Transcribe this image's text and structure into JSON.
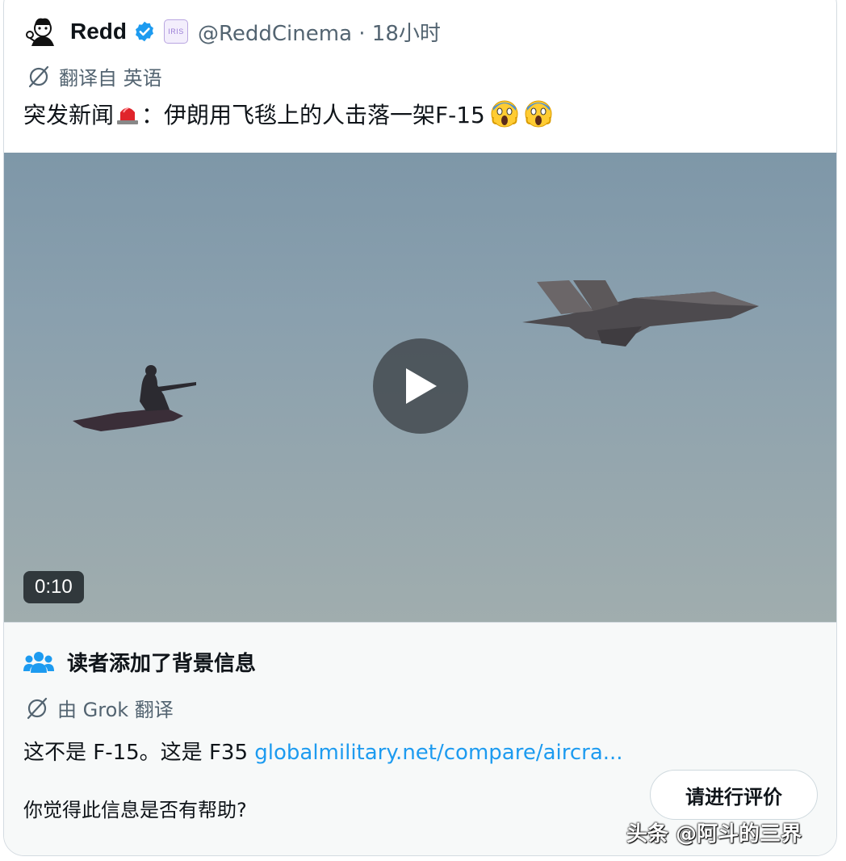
{
  "author": {
    "display_name": "Redd",
    "affiliate_badge": "IRIS",
    "handle_time": "@ReddCinema · 18小时",
    "verified_icon": "verified-badge-icon",
    "avatar_icon": "cartoon-avatar-icon"
  },
  "translation": {
    "label": "翻译自 英语",
    "icon": "translate-icon"
  },
  "tweet": {
    "text_main": "突发新闻",
    "text_rest": "：伊朗用飞毯上的人击落一架F-15"
  },
  "video": {
    "duration": "0:10",
    "play_icon": "play-icon"
  },
  "community_note": {
    "title": "读者添加了背景信息",
    "translated_by": "由 Grok 翻译",
    "text": "这不是 F-15。这是 F35 ",
    "link": "globalmilitary.net/compare/aircra...",
    "helpful_question": "你觉得此信息是否有帮助?",
    "rate_button": "请进行评价"
  },
  "watermark": "头条 @阿斗的三界",
  "colors": {
    "link": "#1d9bf0",
    "secondary_text": "#536471",
    "verified": "#1d9bf0",
    "note_background": "#f7f9f9"
  }
}
